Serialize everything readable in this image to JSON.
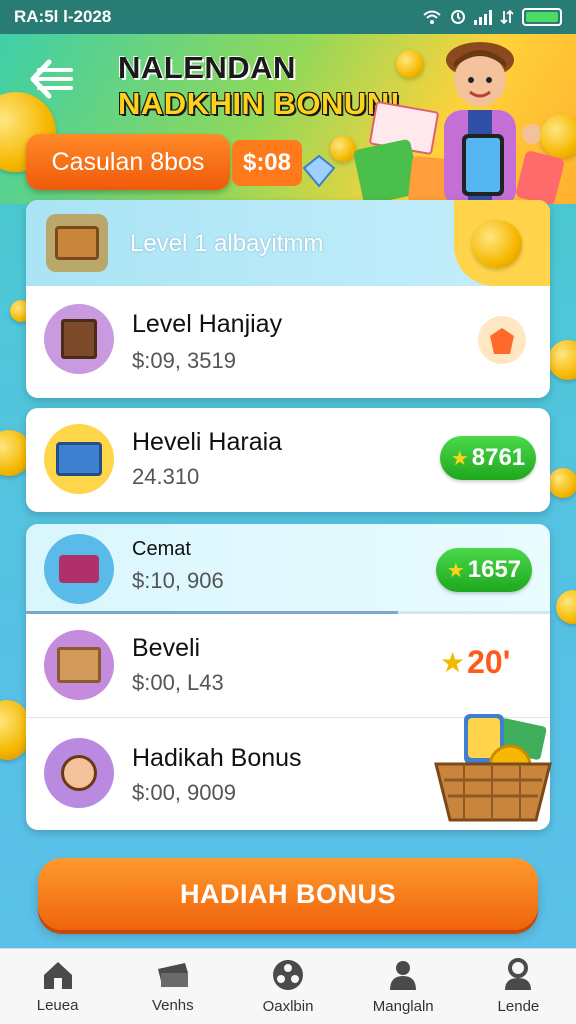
{
  "status_bar": {
    "time": "RA:5l l-2028"
  },
  "header": {
    "title_line1": "NALENDAN",
    "title_line2": "NADKHIN BONUN!",
    "balance_label": "Casulan 8bos",
    "balance_amount": "$:08"
  },
  "level_banner": {
    "label": "Level 1 albayitmm"
  },
  "rows": [
    {
      "title": "Level Hanjiay",
      "subtitle": "$:09, 3519",
      "badge": ""
    },
    {
      "title": "Heveli Haraia",
      "subtitle": "24.310",
      "badge": "8761"
    },
    {
      "title": "Cemat",
      "subtitle": "$:10, 906",
      "badge": "1657"
    },
    {
      "title": "Beveli",
      "subtitle": "$:00, L43",
      "badge": "20'"
    },
    {
      "title": "Hadikah Bonus",
      "subtitle": "$:00, 9009",
      "badge": ""
    }
  ],
  "progress": {
    "value": 0.71
  },
  "bonus_button": {
    "label": "HADIAH BONUS"
  },
  "bottom_nav": [
    {
      "label": "Leuea",
      "icon": "home-icon"
    },
    {
      "label": "Venhs",
      "icon": "ticket-icon"
    },
    {
      "label": "Oaxlbin",
      "icon": "ball-icon"
    },
    {
      "label": "Manglaln",
      "icon": "user-group-icon"
    },
    {
      "label": "Lende",
      "icon": "profile-icon"
    }
  ],
  "colors": {
    "accent_orange": "#f0630c",
    "badge_green": "#1fa81f",
    "coin_gold": "#f5b800"
  }
}
